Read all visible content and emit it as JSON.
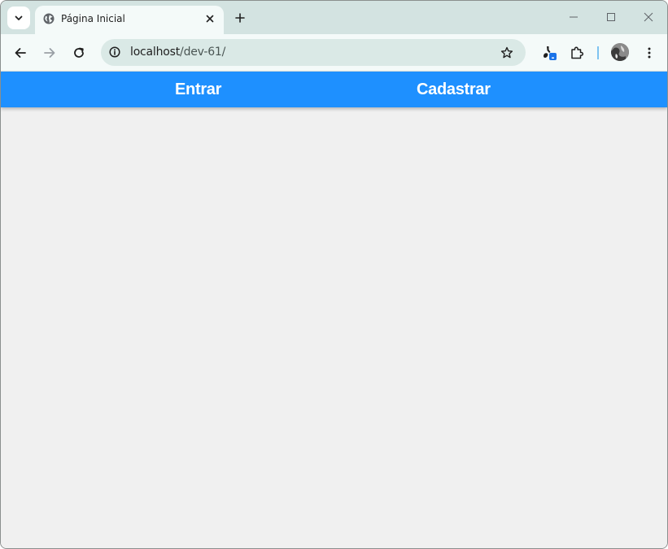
{
  "browser": {
    "tab": {
      "title": "Página Inicial"
    },
    "address": {
      "host": "localhost",
      "path": "/dev-61/"
    }
  },
  "nav": {
    "login_label": "Entrar",
    "register_label": "Cadastrar"
  },
  "colors": {
    "navbar_bg": "#1e90ff",
    "page_bg": "#f0f0f0",
    "tabstrip_bg": "#d3e3e1",
    "toolbar_bg": "#f4faf9",
    "omnibox_bg": "#dae9e6"
  },
  "icons": {
    "tab_search": "chevron-down-icon",
    "favicon": "globe-icon",
    "tab_close": "close-icon",
    "new_tab": "plus-icon",
    "back": "arrow-left-icon",
    "forward": "arrow-right-icon",
    "reload": "reload-icon",
    "site_info": "info-icon",
    "bookmark": "star-icon",
    "extension_active": "paint-icon",
    "extensions": "puzzle-icon",
    "menu": "kebab-menu-icon"
  }
}
